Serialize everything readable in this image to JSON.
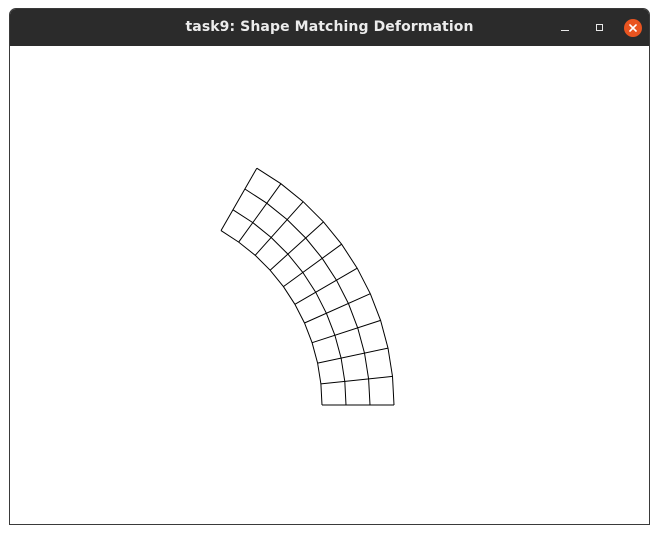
{
  "window": {
    "title": "task9: Shape Matching Deformation",
    "controls": {
      "minimize": "minimize-icon",
      "maximize": "maximize-icon",
      "close": "close-icon"
    },
    "close_color": "#e95420",
    "titlebar_color": "#2b2b2b"
  },
  "scene": {
    "background": "#ffffff",
    "line_color": "#000000",
    "mesh_columns": 3,
    "mesh_rows": 10
  }
}
